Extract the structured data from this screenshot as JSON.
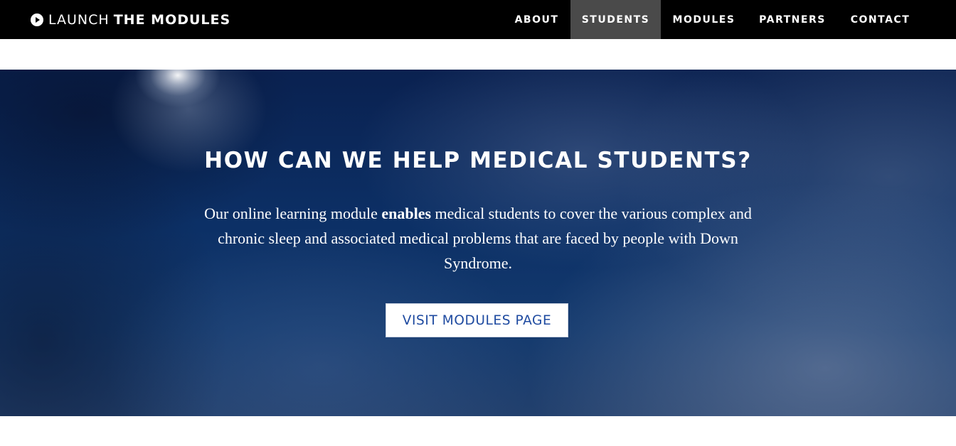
{
  "nav": {
    "brand_light": "LAUNCH",
    "brand_bold": "THE MODULES",
    "brand_icon": "play-circle-icon",
    "items": [
      {
        "label": "ABOUT",
        "active": false
      },
      {
        "label": "STUDENTS",
        "active": true
      },
      {
        "label": "MODULES",
        "active": false
      },
      {
        "label": "PARTNERS",
        "active": false
      },
      {
        "label": "CONTACT",
        "active": false
      }
    ]
  },
  "hero": {
    "title": "HOW CAN WE HELP MEDICAL STUDENTS?",
    "text_before": "Our online learning module ",
    "text_bold": "enables",
    "text_after": " medical students to cover the various complex and chronic sleep and associated medical problems that are faced by people with Down Syndrome.",
    "button_label": "VISIT MODULES PAGE"
  },
  "colors": {
    "navbar_bg": "#000000",
    "nav_active_bg": "#4a4a4a",
    "button_text": "#1e4aa0",
    "hero_bg": "#0c3066"
  }
}
